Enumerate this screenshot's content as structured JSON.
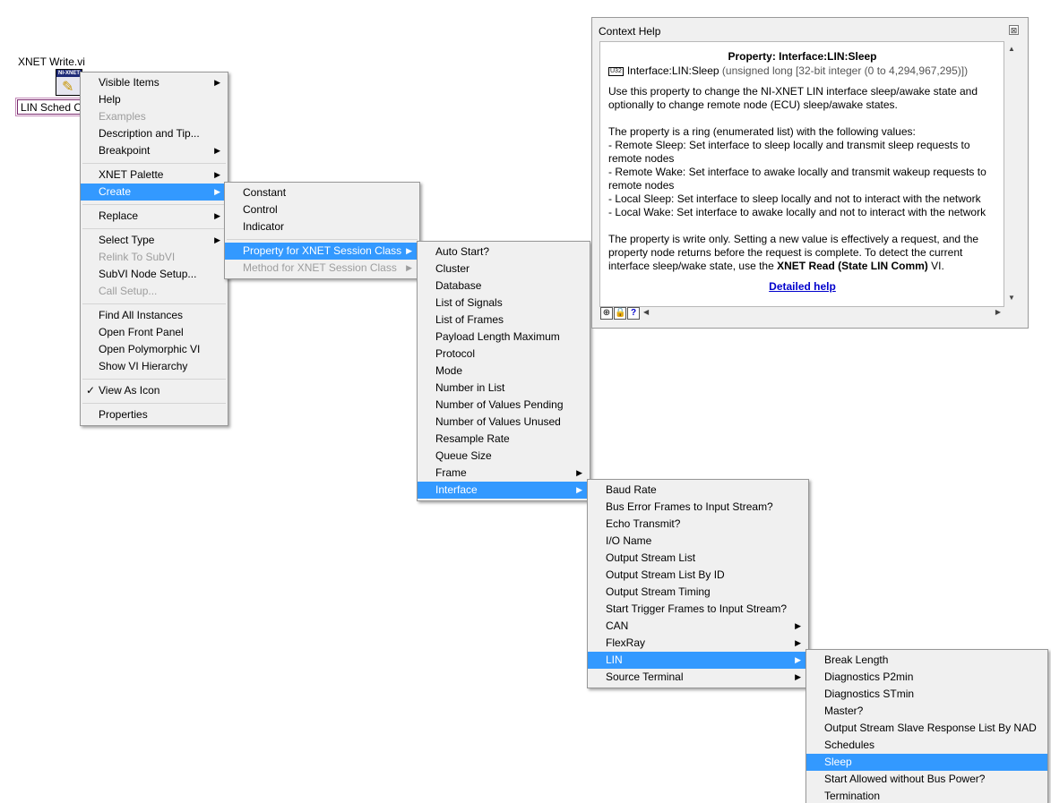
{
  "diagram": {
    "vi_label": "XNET Write.vi",
    "vi_icon_header": "NI-XNET",
    "constant_text": "LIN Sched Ch"
  },
  "menu1": {
    "items": [
      {
        "label": "Visible Items",
        "submenu": true
      },
      {
        "label": "Help"
      },
      {
        "label": "Examples",
        "disabled": true
      },
      {
        "label": "Description and Tip..."
      },
      {
        "label": "Breakpoint",
        "submenu": true
      },
      {
        "label": "XNET Palette",
        "submenu": true
      },
      {
        "label": "Create",
        "submenu": true,
        "highlighted": true
      },
      {
        "label": "Replace",
        "submenu": true
      },
      {
        "label": "Select Type",
        "submenu": true
      },
      {
        "label": "Relink To SubVI",
        "disabled": true
      },
      {
        "label": "SubVI Node Setup..."
      },
      {
        "label": "Call Setup...",
        "disabled": true
      },
      {
        "label": "Find All Instances"
      },
      {
        "label": "Open Front Panel"
      },
      {
        "label": "Open Polymorphic VI"
      },
      {
        "label": "Show VI Hierarchy"
      },
      {
        "label": "View As Icon",
        "checked": true
      },
      {
        "label": "Properties"
      }
    ]
  },
  "menu2": {
    "items": [
      {
        "label": "Constant"
      },
      {
        "label": "Control"
      },
      {
        "label": "Indicator"
      },
      {
        "label": "Property for XNET Session Class",
        "submenu": true,
        "highlighted": true
      },
      {
        "label": "Method for XNET Session Class",
        "submenu": true,
        "disabled": true
      }
    ]
  },
  "menu3": {
    "items": [
      {
        "label": "Auto Start?"
      },
      {
        "label": "Cluster"
      },
      {
        "label": "Database"
      },
      {
        "label": "List of Signals"
      },
      {
        "label": "List of Frames"
      },
      {
        "label": "Payload Length Maximum"
      },
      {
        "label": "Protocol"
      },
      {
        "label": "Mode"
      },
      {
        "label": "Number in List"
      },
      {
        "label": "Number of Values Pending"
      },
      {
        "label": "Number of Values Unused"
      },
      {
        "label": "Resample Rate"
      },
      {
        "label": "Queue Size"
      },
      {
        "label": "Frame",
        "submenu": true
      },
      {
        "label": "Interface",
        "submenu": true,
        "highlighted": true
      }
    ]
  },
  "menu4": {
    "items": [
      {
        "label": "Baud Rate"
      },
      {
        "label": "Bus Error Frames to Input Stream?"
      },
      {
        "label": "Echo Transmit?"
      },
      {
        "label": "I/O Name"
      },
      {
        "label": "Output Stream List"
      },
      {
        "label": "Output Stream List By ID"
      },
      {
        "label": "Output Stream Timing"
      },
      {
        "label": "Start Trigger Frames to Input Stream?"
      },
      {
        "label": "CAN",
        "submenu": true
      },
      {
        "label": "FlexRay",
        "submenu": true
      },
      {
        "label": "LIN",
        "submenu": true,
        "highlighted": true
      },
      {
        "label": "Source Terminal",
        "submenu": true
      }
    ]
  },
  "menu5": {
    "items": [
      {
        "label": "Break Length"
      },
      {
        "label": "Diagnostics P2min"
      },
      {
        "label": "Diagnostics STmin"
      },
      {
        "label": "Master?"
      },
      {
        "label": "Output Stream Slave Response List By NAD"
      },
      {
        "label": "Schedules"
      },
      {
        "label": "Sleep",
        "highlighted": true
      },
      {
        "label": "Start Allowed without Bus Power?"
      },
      {
        "label": "Termination"
      }
    ]
  },
  "help": {
    "window_title": "Context Help",
    "close_glyph": "⊠",
    "title": "Property:  Interface:LIN:Sleep",
    "type_badge": "U32",
    "sig_name": "Interface:LIN:Sleep",
    "sig_type": " (unsigned long [32-bit integer (0 to 4,294,967,295)])",
    "p1": "Use this property to change the NI-XNET LIN interface sleep/awake state and optionally to change remote node (ECU) sleep/awake states.",
    "p2_lines": [
      "The property is a ring (enumerated list) with the following values:",
      "- Remote Sleep: Set interface to sleep locally and transmit sleep requests to remote nodes",
      "- Remote Wake: Set interface to awake locally and transmit wakeup requests to remote nodes",
      "- Local Sleep: Set interface to sleep locally and not to interact with the network",
      "- Local Wake: Set interface to awake locally and not to interact with the network"
    ],
    "p3_before": "The property is write only. Setting a new value is effectively a request, and the property node returns before the request is complete. To detect the current interface sleep/wake state, use the ",
    "p3_bold": "XNET Read (State LIN Comm)",
    "p3_after": " VI.",
    "link": "Detailed help",
    "toolbar": {
      "show_optional": "⊕",
      "lock": "🔒",
      "help": "?"
    }
  }
}
